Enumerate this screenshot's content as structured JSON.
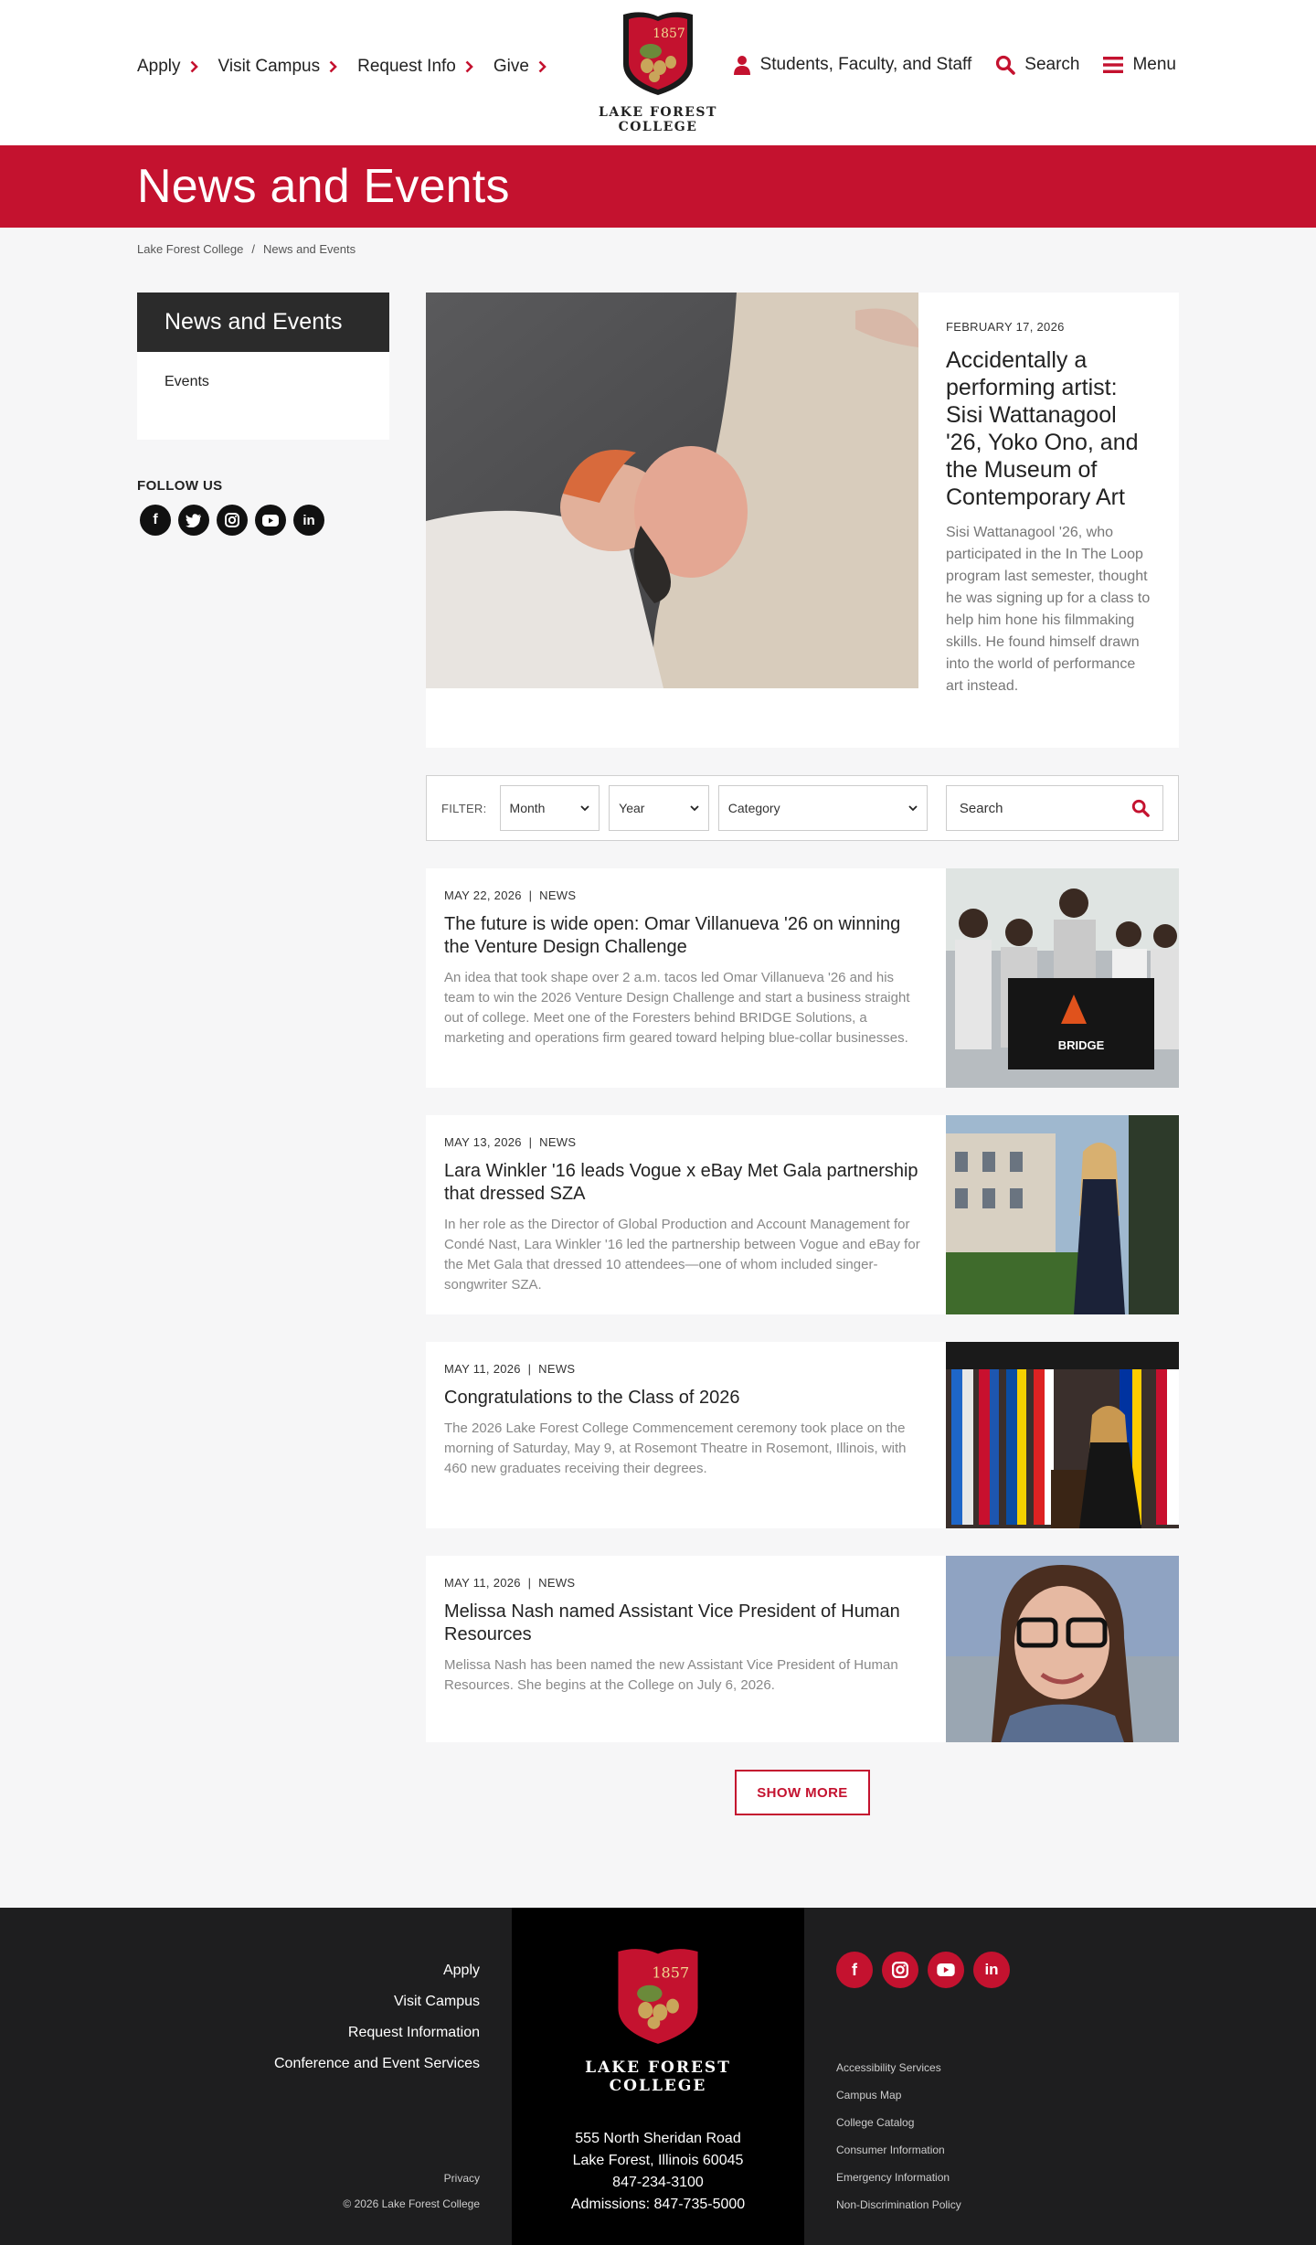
{
  "header": {
    "nav_left": [
      "Apply",
      "Visit Campus",
      "Request Info",
      "Give"
    ],
    "logo_year": "1857",
    "logo_line1": "LAKE FOREST",
    "logo_line2": "COLLEGE",
    "nav_right": {
      "people": "Students, Faculty, and Staff",
      "search": "Search",
      "menu": "Menu"
    }
  },
  "banner": {
    "title": "News and Events"
  },
  "breadcrumb": {
    "home": "Lake Forest College",
    "sep": "/",
    "current": "News and Events"
  },
  "sidebar": {
    "title": "News and Events",
    "items": [
      "Events"
    ],
    "follow_label": "FOLLOW US",
    "social": [
      "facebook",
      "twitter",
      "instagram",
      "youtube",
      "linkedin"
    ]
  },
  "featured": {
    "date": "FEBRUARY 17, 2026",
    "title": "Accidentally a performing artist: Sisi Wattanagool '26, Yoko Ono, and the Museum of Contemporary Art",
    "summary": "Sisi Wattanagool '26, who participated in the In The Loop program last semester, thought he was signing up for a class to help him hone his filmmaking skills. He found himself drawn into the world of performance art instead."
  },
  "filter": {
    "label": "FILTER:",
    "month": "Month",
    "year": "Year",
    "category": "Category",
    "search_placeholder": "Search"
  },
  "articles": [
    {
      "date": "MAY 22, 2026",
      "category": "NEWS",
      "title": "The future is wide open: Omar Villanueva '26 on winning the Venture Design Challenge",
      "summary": "An idea that took shape over 2 a.m. tacos led Omar Villanueva '26 and his team to win the 2026 Venture Design Challenge and start a business straight out of college. Meet one of the Foresters behind BRIDGE Solutions, a marketing and operations firm geared toward helping blue-collar businesses.",
      "sign": "BRIDGE"
    },
    {
      "date": "MAY 13, 2026",
      "category": "NEWS",
      "title": "Lara Winkler '16 leads Vogue x eBay Met Gala partnership that dressed SZA",
      "summary": "In her role as the Director of Global Production and Account Management for Condé Nast, Lara Winkler '16 led the partnership between Vogue and eBay for the Met Gala that dressed 10 attendees—one of whom included singer-songwriter SZA."
    },
    {
      "date": "MAY 11, 2026",
      "category": "NEWS",
      "title": "Congratulations to the Class of 2026",
      "summary": "The 2026 Lake Forest College Commencement ceremony took place on the morning of Saturday, May 9, at Rosemont Theatre in Rosemont, Illinois, with 460 new graduates receiving their degrees."
    },
    {
      "date": "MAY 11, 2026",
      "category": "NEWS",
      "title": "Melissa Nash named Assistant Vice President of Human Resources",
      "summary": "Melissa Nash has been named the new Assistant Vice President of Human Resources. She begins at the College on July 6, 2026."
    }
  ],
  "show_more": "SHOW MORE",
  "footer": {
    "links": [
      "Apply",
      "Visit Campus",
      "Request Information",
      "Conference and Event Services"
    ],
    "privacy": "Privacy",
    "copyright": "© 2026 Lake Forest College",
    "address1": "555 North Sheridan Road",
    "address2": "Lake Forest, Illinois 60045",
    "phone": "847-234-3100",
    "admissions": "Admissions: 847-735-5000",
    "utility": [
      "Accessibility Services",
      "Campus Map",
      "College Catalog",
      "Consumer Information",
      "Emergency Information",
      "Non-Discrimination Policy"
    ]
  },
  "colors": {
    "brand_red": "#c4122f",
    "dark": "#1e1e1f"
  }
}
